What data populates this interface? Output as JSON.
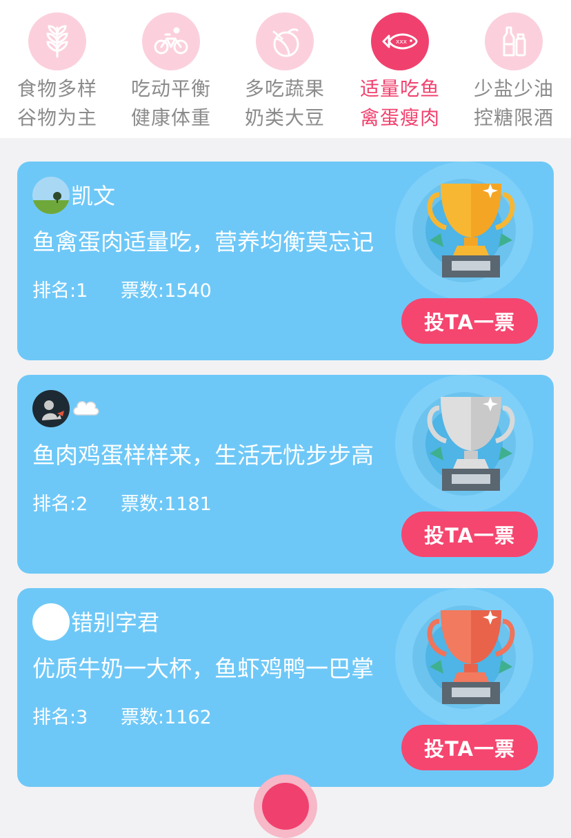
{
  "categories": [
    {
      "icon": "wheat-icon",
      "line1": "食物多样",
      "line2": "谷物为主",
      "active": false
    },
    {
      "icon": "bicycle-icon",
      "line1": "吃动平衡",
      "line2": "健康体重",
      "active": false
    },
    {
      "icon": "fruit-icon",
      "line1": "多吃蔬果",
      "line2": "奶类大豆",
      "active": false
    },
    {
      "icon": "fish-icon",
      "line1": "适量吃鱼",
      "line2": "禽蛋瘦肉",
      "active": true
    },
    {
      "icon": "bottles-icon",
      "line1": "少盐少油",
      "line2": "控糖限酒",
      "active": false
    }
  ],
  "fish_icon_text": "xxx",
  "entries": [
    {
      "username": "凯文",
      "slogan": "鱼禽蛋肉适量吃，营养均衡莫忘记",
      "rank": "排名:1",
      "votes": "票数:1540",
      "button": "投TA一票",
      "trophy": "gold-trophy-icon"
    },
    {
      "username": "",
      "slogan": "鱼肉鸡蛋样样来，生活无忧步步高",
      "rank": "排名:2",
      "votes": "票数:1181",
      "button": "投TA一票",
      "trophy": "silver-trophy-icon"
    },
    {
      "username": "错别字君",
      "slogan": "优质牛奶一大杯，鱼虾鸡鸭一巴掌",
      "rank": "排名:3",
      "votes": "票数:1162",
      "button": "投TA一票",
      "trophy": "bronze-trophy-icon"
    }
  ],
  "colors": {
    "accent": "#f0416e",
    "card_bg": "#6ec8f7",
    "button_bg": "#f5466f",
    "gold": "#f7b733",
    "silver": "#d9d9d9",
    "bronze": "#f0735a"
  }
}
